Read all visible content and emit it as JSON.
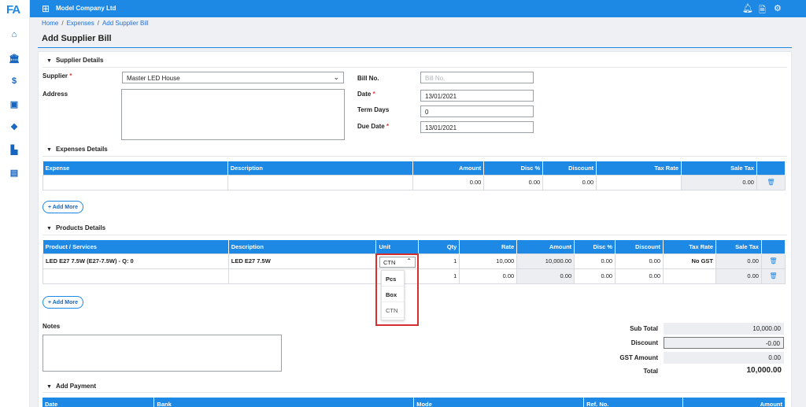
{
  "app": {
    "logo": "FA",
    "company": "Model Company Ltd"
  },
  "breadcrumb": [
    "Home",
    "Expenses",
    "Add Supplier Bill"
  ],
  "page": {
    "title": "Add Supplier Bill"
  },
  "supplier_section": {
    "title": "Supplier Details",
    "supplier_label": "Supplier",
    "supplier_value": "Master LED House",
    "address_label": "Address",
    "address_value": "",
    "bill_no_label": "Bill No.",
    "bill_no_placeholder": "Bill No.",
    "date_label": "Date",
    "date_value": "13/01/2021",
    "term_days_label": "Term Days",
    "term_days_value": "0",
    "due_date_label": "Due Date",
    "due_date_value": "13/01/2021"
  },
  "expenses_section": {
    "title": "Expenses Details",
    "columns": [
      "Expense",
      "Description",
      "Amount",
      "Disc %",
      "Discount",
      "Tax Rate",
      "Sale Tax"
    ],
    "rows": [
      {
        "expense": "",
        "description": "",
        "amount": "0.00",
        "disc_pct": "0.00",
        "discount": "0.00",
        "tax_rate": "",
        "sale_tax": "0.00"
      }
    ],
    "add_more": "+ Add More"
  },
  "products_section": {
    "title": "Products Details",
    "columns": [
      "Product / Services",
      "Description",
      "Unit",
      "Qty",
      "Rate",
      "Amount",
      "Disc %",
      "Discount",
      "Tax Rate",
      "Sale Tax"
    ],
    "rows": [
      {
        "product": "LED E27 7.5W (E27-7.5W) - Q: 0",
        "description": "LED E27 7.5W",
        "unit": "CTN",
        "qty": "1",
        "rate": "10,000",
        "amount": "10,000.00",
        "disc_pct": "0.00",
        "discount": "0.00",
        "tax_rate": "No GST",
        "sale_tax": "0.00"
      },
      {
        "product": "",
        "description": "",
        "unit": "",
        "qty": "1",
        "rate": "0.00",
        "amount": "0.00",
        "disc_pct": "0.00",
        "discount": "0.00",
        "tax_rate": "",
        "sale_tax": "0.00"
      }
    ],
    "unit_options": [
      "Pcs",
      "Box",
      "CTN"
    ],
    "add_more": "+ Add More"
  },
  "notes": {
    "label": "Notes",
    "value": ""
  },
  "totals": {
    "sub_total_label": "Sub Total",
    "sub_total": "10,000.00",
    "discount_label": "Discount",
    "discount": "-0.00",
    "gst_label": "GST Amount",
    "gst": "0.00",
    "total_label": "Total",
    "total": "10,000.00"
  },
  "payment_section": {
    "title": "Add Payment",
    "columns": [
      "Date",
      "Bank",
      "Mode",
      "Ref. No.",
      "Amount"
    ]
  },
  "colors": {
    "primary": "#1e88e5",
    "highlight": "#d32f2f",
    "required": "#e53935"
  }
}
